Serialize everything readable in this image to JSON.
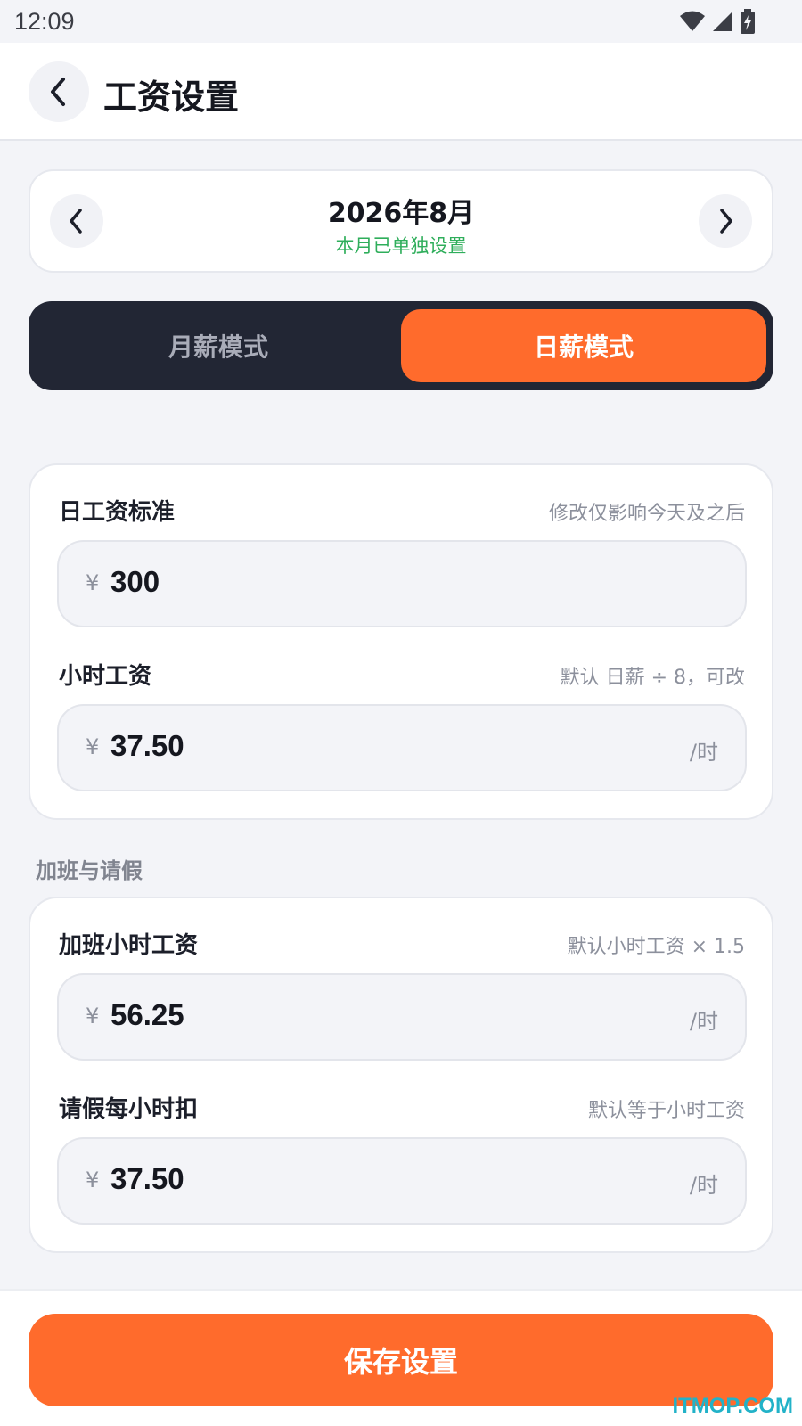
{
  "status_bar": {
    "time": "12:09"
  },
  "header": {
    "title": "工资设置",
    "back_icon": "chevron-left-icon"
  },
  "month_selector": {
    "title": "2026年8月",
    "subtitle": "本月已单独设置",
    "subtitle_color": "#2fae5b",
    "prev_icon": "chevron-left-icon",
    "next_icon": "chevron-right-icon"
  },
  "mode_toggle": {
    "options": [
      "月薪模式",
      "日薪模式"
    ],
    "selected": "日薪模式",
    "active_color": "#ff6b2c"
  },
  "salary_card": {
    "daily_wage": {
      "label": "日工资标准",
      "hint": "修改仅影响今天及之后",
      "currency": "¥",
      "value": "300"
    },
    "hourly_wage": {
      "label": "小时工资",
      "hint": "默认 日薪 ÷ 8，可改",
      "currency": "¥",
      "value": "37.50",
      "unit": "/时"
    }
  },
  "overtime_section": {
    "title": "加班与请假",
    "overtime_hourly": {
      "label": "加班小时工资",
      "hint": "默认小时工资 × 1.5",
      "currency": "¥",
      "value": "56.25",
      "unit": "/时"
    },
    "leave_deduction": {
      "label": "请假每小时扣",
      "hint": "默认等于小时工资",
      "currency": "¥",
      "value": "37.50",
      "unit": "/时"
    }
  },
  "footer": {
    "save_label": "保存设置"
  },
  "watermark": "ITMOP.COM"
}
